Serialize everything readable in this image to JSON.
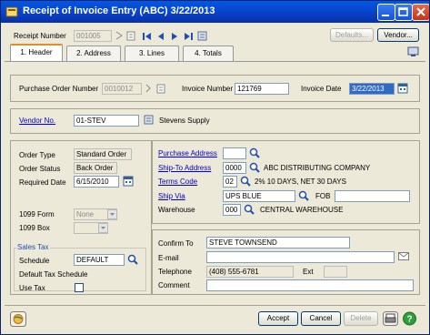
{
  "window": {
    "title": "Receipt of Invoice Entry (ABC) 3/22/2013"
  },
  "top": {
    "receipt_number_label": "Receipt Number",
    "receipt_number_value": "001005",
    "defaults_label": "Defaults...",
    "vendor_label": "Vendor..."
  },
  "tabs": [
    {
      "label": "1. Header"
    },
    {
      "label": "2. Address"
    },
    {
      "label": "3. Lines"
    },
    {
      "label": "4. Totals"
    }
  ],
  "po": {
    "label": "Purchase Order Number",
    "value": "0010012",
    "invoice_number_label": "Invoice Number",
    "invoice_number_value": "121769",
    "invoice_date_label": "Invoice Date",
    "invoice_date_value": "3/22/2013"
  },
  "vendor": {
    "label": "Vendor No.",
    "value": "01-STEV",
    "name": "Stevens Supply"
  },
  "order": {
    "type_label": "Order Type",
    "type_value": "Standard Order",
    "status_label": "Order Status",
    "status_value": "Back Order",
    "required_label": "Required Date",
    "required_value": "6/15/2010",
    "form_1099_label": "1099 Form",
    "form_1099_value": "None",
    "box_1099_label": "1099 Box",
    "box_1099_value": ""
  },
  "sales_tax": {
    "title": "Sales Tax",
    "schedule_label": "Schedule",
    "schedule_value": "DEFAULT",
    "default_label": "Default Tax Schedule",
    "use_tax_label": "Use Tax"
  },
  "address": {
    "purchase_label": "Purchase Address",
    "purchase_value": "",
    "ship_to_label": "Ship-To Address",
    "ship_to_value": "0000",
    "ship_to_name": "ABC DISTRIBUTING COMPANY",
    "terms_label": "Terms Code",
    "terms_value": "02",
    "terms_desc": "2% 10 DAYS, NET 30 DAYS",
    "ship_via_label": "Ship Via",
    "ship_via_value": "UPS BLUE",
    "fob_label": "FOB",
    "fob_value": "",
    "warehouse_label": "Warehouse",
    "warehouse_value": "000",
    "warehouse_name": "CENTRAL WAREHOUSE"
  },
  "contact": {
    "confirm_label": "Confirm To",
    "confirm_value": "STEVE TOWNSEND",
    "email_label": "E-mail",
    "email_value": "",
    "phone_label": "Telephone",
    "phone_value": "(408) 555-6781",
    "ext_label": "Ext",
    "ext_value": "",
    "comment_label": "Comment",
    "comment_value": ""
  },
  "footer": {
    "accept_label": "Accept",
    "cancel_label": "Cancel",
    "delete_label": "Delete"
  },
  "colors": {
    "titlebar": "#0a3fc5",
    "link": "#0000cc",
    "selection": "#316ac5",
    "tab_accent": "#e68b2c"
  }
}
